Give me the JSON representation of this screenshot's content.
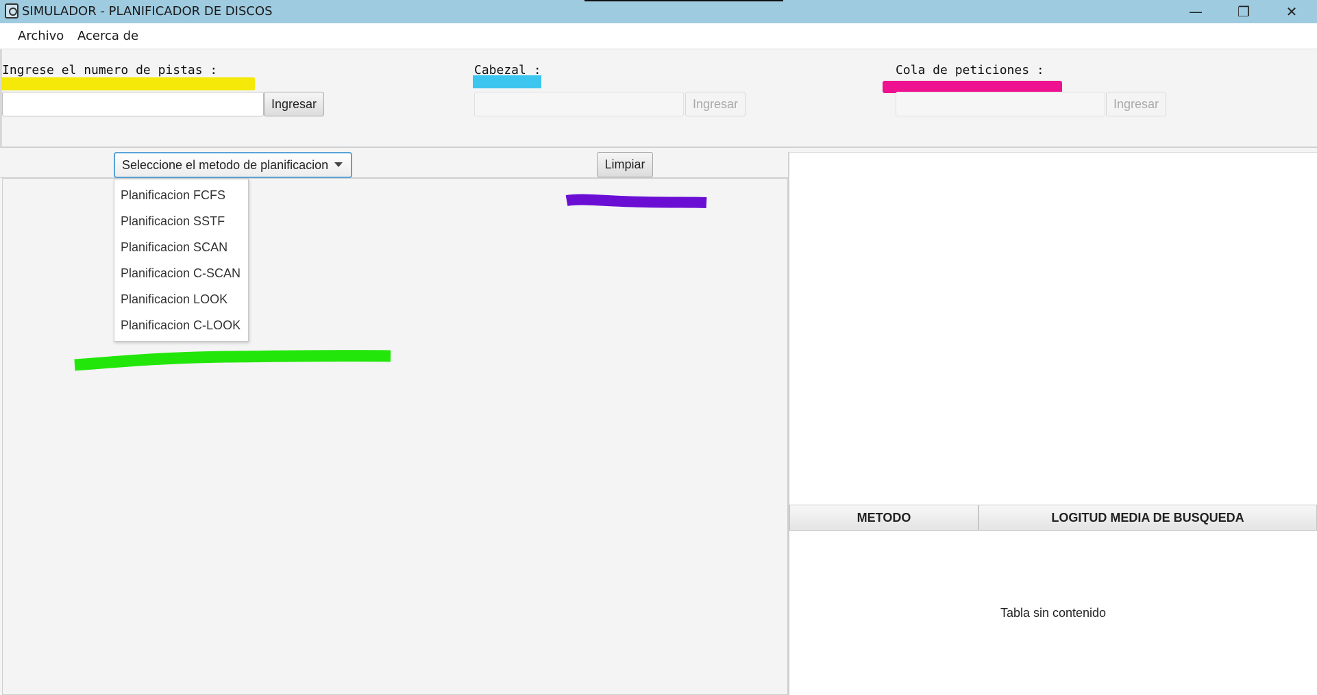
{
  "window": {
    "title": "SIMULADOR - PLANIFICADOR DE DISCOS",
    "controls": {
      "minimize": "—",
      "restore": "❐",
      "close": "✕"
    }
  },
  "menu": {
    "items": [
      "Archivo",
      "Acerca de"
    ]
  },
  "inputs": {
    "pistas": {
      "label": "Ingrese el numero de pistas :",
      "value": "",
      "button": "Ingresar",
      "highlight": "#f5e90a"
    },
    "cabezal": {
      "label": "Cabezal :",
      "value": "",
      "button": "Ingresar",
      "highlight": "#3cc6ef"
    },
    "cola": {
      "label": "Cola de peticiones :",
      "value": "",
      "button": "Ingresar",
      "highlight": "#ee1190"
    }
  },
  "controls": {
    "method_combo": "Seleccione el metodo de planificacion",
    "clear_button": "Limpiar",
    "method_options": [
      "Planificacion FCFS",
      "Planificacion SSTF",
      "Planificacion SCAN",
      "Planificacion C-SCAN",
      "Planificacion LOOK",
      "Planificacion C-LOOK"
    ]
  },
  "marks": {
    "purple": "#6a0ed4",
    "green": "#22e60a"
  },
  "table": {
    "headers": [
      "METODO",
      "LOGITUD MEDIA DE BUSQUEDA"
    ],
    "empty_text": "Tabla sin contenido"
  }
}
